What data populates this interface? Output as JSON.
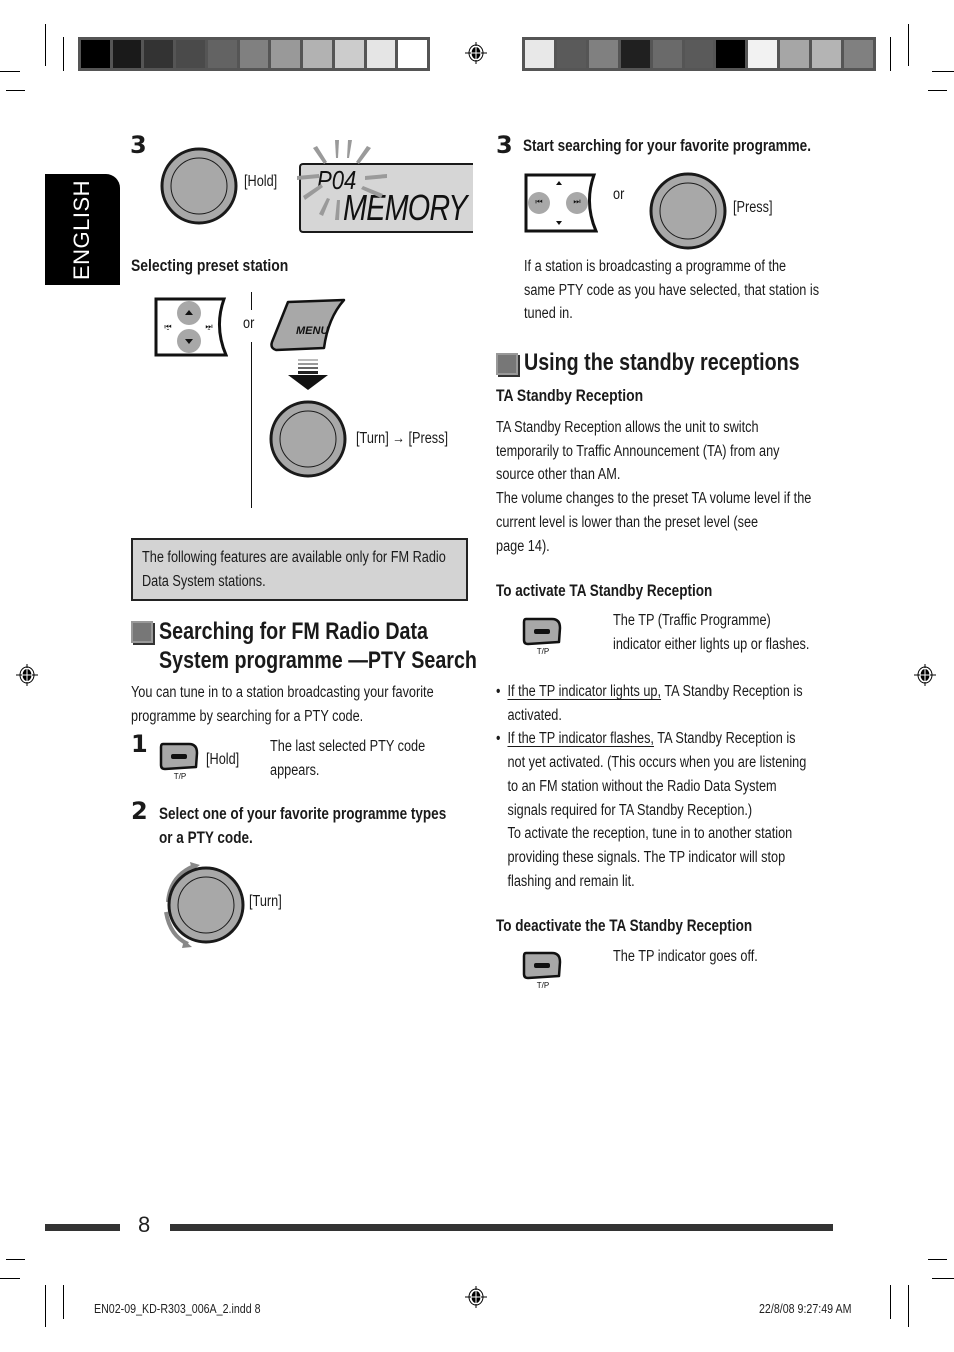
{
  "sidebar": {
    "language_tab": "ENGLISH"
  },
  "left_column": {
    "step3": {
      "number": "3",
      "knob_label": "[Hold]",
      "display_line1": "P04",
      "display_line2": "MEMORY"
    },
    "selecting_preset": {
      "heading": "Selecting preset station",
      "or_label": "or",
      "menu_button_label": "MENU",
      "knob_label": "[Turn] → [Press]"
    },
    "note": "The following features are available only for FM Radio Data System stations.",
    "pty_section": {
      "title_line1": "Searching for FM Radio Data",
      "title_line2": "System programme —PTY Search",
      "intro": "You can tune in to a station broadcasting your favorite programme by searching for a PTY code.",
      "step1": {
        "number": "1",
        "button_label": "T/P",
        "action_label": "[Hold]",
        "description": "The last selected PTY code appears."
      },
      "step2": {
        "number": "2",
        "instruction_line1": "Select one of your favorite programme types",
        "instruction_line2": "or a PTY code.",
        "knob_label": "[Turn]"
      }
    }
  },
  "right_column": {
    "step3": {
      "number": "3",
      "instruction": "Start searching for your favorite programme.",
      "or_label": "or",
      "knob_label": "[Press]",
      "description_lines": [
        "If a station is broadcasting a programme of the",
        "same PTY code as you have selected, that station is",
        "tuned in."
      ]
    },
    "standby_section": {
      "title": "Using the standby receptions",
      "subheading": "TA Standby Reception",
      "paragraph_lines": [
        "TA Standby Reception allows the unit to switch",
        "temporarily to Traffic Announcement (TA) from any",
        "source other than AM.",
        "The volume changes to the preset TA volume level if the",
        "current level is lower than the preset level (see",
        "page 14)."
      ],
      "activate": {
        "heading": "To activate TA Standby Reception",
        "button_label": "T/P",
        "description_line1": "The TP (Traffic Programme)",
        "description_line2": "indicator either lights up or flashes."
      },
      "bullets": [
        {
          "underlined": "If the TP indicator lights up,",
          "lines": [
            " TA Standby Reception is",
            "activated."
          ]
        },
        {
          "underlined": "If the TP indicator flashes,",
          "lines": [
            " TA Standby Reception is",
            "not yet activated. (This occurs when you are listening",
            "to an FM station without the Radio Data System",
            "signals required for TA Standby Reception.)",
            "To activate the reception, tune in to another station",
            "providing these signals. The TP indicator will stop",
            "flashing and remain lit."
          ]
        }
      ],
      "deactivate": {
        "heading": "To deactivate the TA Standby Reception",
        "button_label": "T/P",
        "description": "The TP indicator goes off."
      }
    }
  },
  "footer": {
    "page_number": "8",
    "file_name": "EN02-09_KD-R303_006A_2.indd   8",
    "timestamp": "22/8/08   9:27:49 AM"
  },
  "print_marks": {
    "left_strip": [
      "#000000",
      "#1a1a1a",
      "#333333",
      "#4a4a4a",
      "#636363",
      "#808080",
      "#999999",
      "#b2b2b2",
      "#cccccc",
      "#e5e5e5",
      "#ffffff"
    ],
    "right_strip": [
      "#e8e8e8",
      "#5a5a5a",
      "#808080",
      "#202020",
      "#6a6a6a",
      "#5a5a5a",
      "#000000",
      "#f2f2f2",
      "#a6a6a6",
      "#b4b4b4",
      "#808080"
    ]
  }
}
